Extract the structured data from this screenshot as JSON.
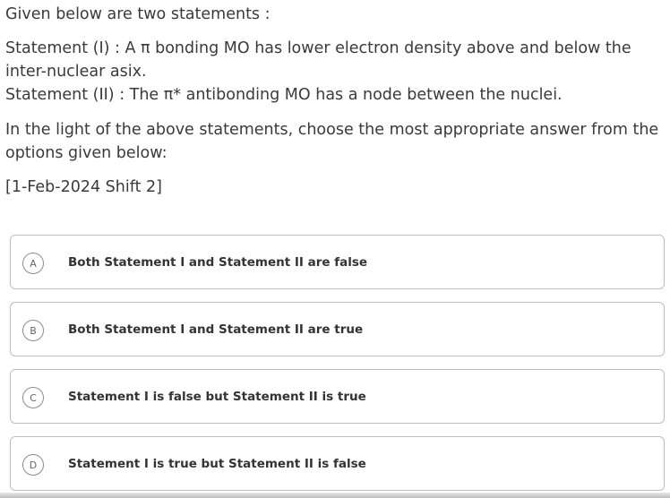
{
  "question": {
    "intro": "Given below are two statements :",
    "statement_1": "Statement (I) : A π bonding MO has lower electron density above and below the inter-nuclear asix.",
    "statement_2": "Statement (II) : The π* antibonding MO has a node between the nuclei.",
    "instruction": "In the light of the above statements, choose the most appropriate answer from the options given below:",
    "meta": "[1-Feb-2024 Shift 2]"
  },
  "options": [
    {
      "letter": "A",
      "text": "Both Statement I and Statement II are false"
    },
    {
      "letter": "B",
      "text": "Both Statement I and Statement II are true"
    },
    {
      "letter": "C",
      "text": "Statement I is false but Statement II is true"
    },
    {
      "letter": "D",
      "text": "Statement I is true but Statement II is false"
    }
  ],
  "colors": {
    "text": "#3a3a3a",
    "border": "#bdbdbd",
    "background": "#ffffff"
  }
}
